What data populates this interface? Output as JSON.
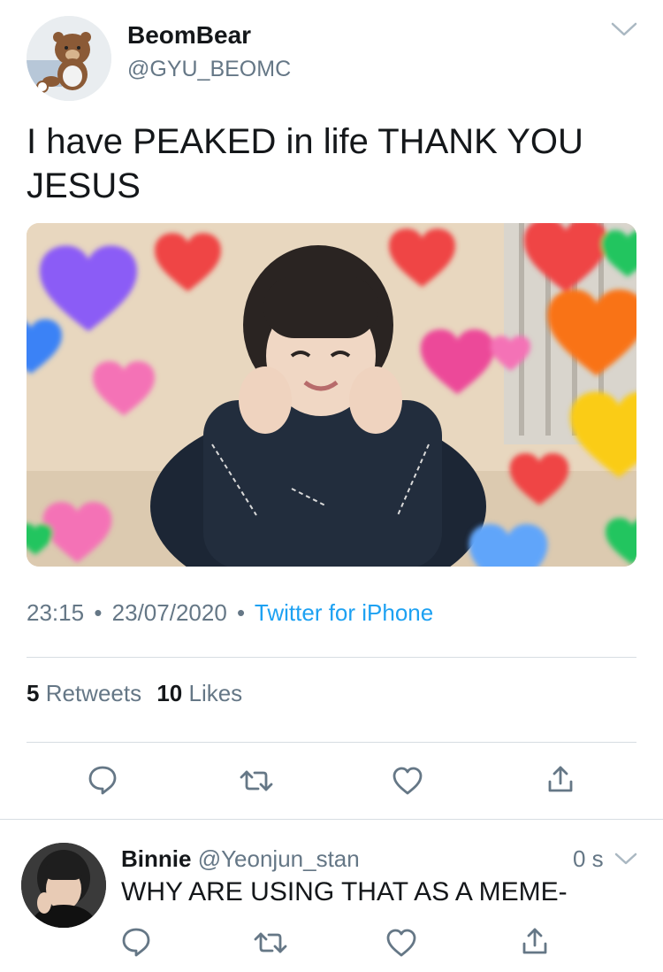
{
  "tweet": {
    "author": {
      "name": "BeomBear",
      "handle": "@GYU_BEOMC",
      "avatar_icon": "bear-avatar"
    },
    "text": "I have PEAKED in life THANK YOU JESUS",
    "text_line1": "I have PEAKED in life THANK YOU",
    "text_line2": "JESUS",
    "image_desc_icon": "photo-person-with-hearts",
    "time": "23:15",
    "date": "23/07/2020",
    "source": "Twitter for iPhone",
    "stats": {
      "retweets_count": "5",
      "retweets_label": "Retweets",
      "likes_count": "10",
      "likes_label": "Likes"
    },
    "actions": [
      "reply-icon",
      "retweet-icon",
      "like-icon",
      "share-icon"
    ]
  },
  "reply": {
    "author": {
      "name": "Binnie",
      "handle": "@Yeonjun_stan",
      "avatar_icon": "person-avatar"
    },
    "time": "0 s",
    "text": "WHY ARE USING THAT AS A MEME-",
    "actions": [
      "reply-icon",
      "retweet-icon",
      "like-icon",
      "share-icon"
    ]
  },
  "colors": {
    "accent": "#1da1f2",
    "muted": "#657786",
    "divider": "#d7dde2"
  },
  "separator": "•"
}
